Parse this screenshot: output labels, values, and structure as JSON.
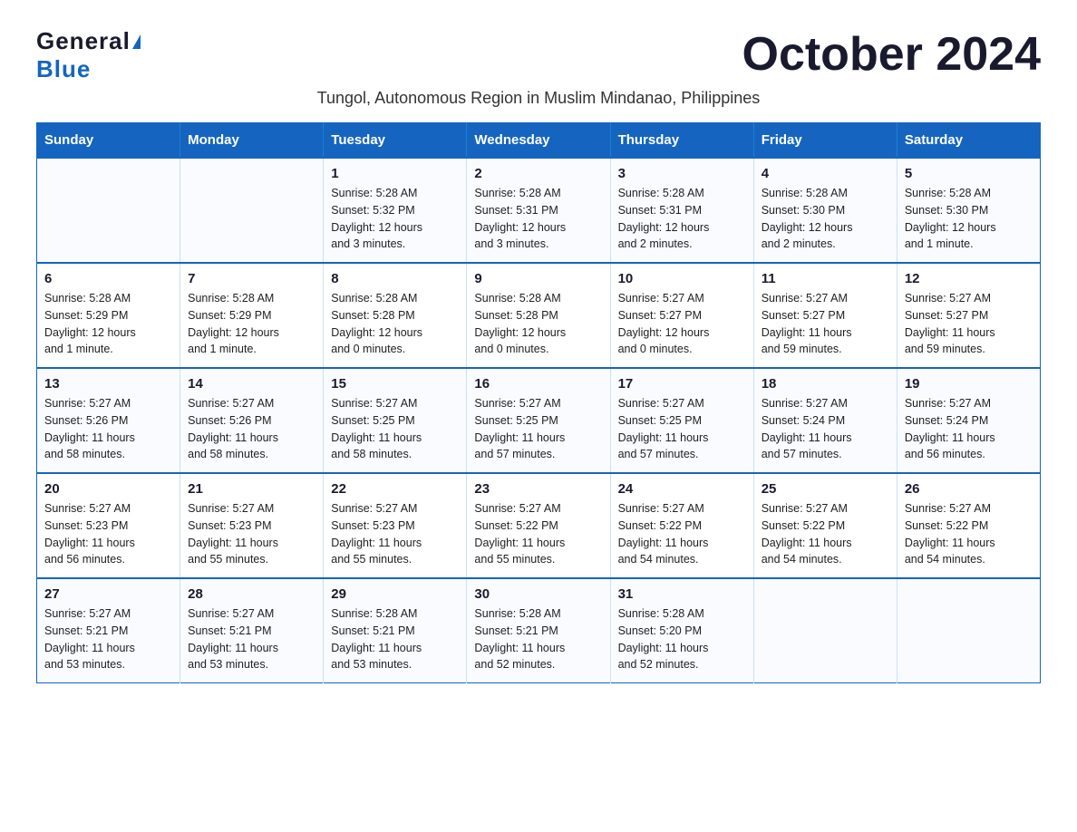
{
  "logo": {
    "general": "General",
    "blue": "Blue"
  },
  "title": "October 2024",
  "subtitle": "Tungol, Autonomous Region in Muslim Mindanao, Philippines",
  "days_of_week": [
    "Sunday",
    "Monday",
    "Tuesday",
    "Wednesday",
    "Thursday",
    "Friday",
    "Saturday"
  ],
  "weeks": [
    [
      {
        "day": "",
        "info": ""
      },
      {
        "day": "",
        "info": ""
      },
      {
        "day": "1",
        "info": "Sunrise: 5:28 AM\nSunset: 5:32 PM\nDaylight: 12 hours\nand 3 minutes."
      },
      {
        "day": "2",
        "info": "Sunrise: 5:28 AM\nSunset: 5:31 PM\nDaylight: 12 hours\nand 3 minutes."
      },
      {
        "day": "3",
        "info": "Sunrise: 5:28 AM\nSunset: 5:31 PM\nDaylight: 12 hours\nand 2 minutes."
      },
      {
        "day": "4",
        "info": "Sunrise: 5:28 AM\nSunset: 5:30 PM\nDaylight: 12 hours\nand 2 minutes."
      },
      {
        "day": "5",
        "info": "Sunrise: 5:28 AM\nSunset: 5:30 PM\nDaylight: 12 hours\nand 1 minute."
      }
    ],
    [
      {
        "day": "6",
        "info": "Sunrise: 5:28 AM\nSunset: 5:29 PM\nDaylight: 12 hours\nand 1 minute."
      },
      {
        "day": "7",
        "info": "Sunrise: 5:28 AM\nSunset: 5:29 PM\nDaylight: 12 hours\nand 1 minute."
      },
      {
        "day": "8",
        "info": "Sunrise: 5:28 AM\nSunset: 5:28 PM\nDaylight: 12 hours\nand 0 minutes."
      },
      {
        "day": "9",
        "info": "Sunrise: 5:28 AM\nSunset: 5:28 PM\nDaylight: 12 hours\nand 0 minutes."
      },
      {
        "day": "10",
        "info": "Sunrise: 5:27 AM\nSunset: 5:27 PM\nDaylight: 12 hours\nand 0 minutes."
      },
      {
        "day": "11",
        "info": "Sunrise: 5:27 AM\nSunset: 5:27 PM\nDaylight: 11 hours\nand 59 minutes."
      },
      {
        "day": "12",
        "info": "Sunrise: 5:27 AM\nSunset: 5:27 PM\nDaylight: 11 hours\nand 59 minutes."
      }
    ],
    [
      {
        "day": "13",
        "info": "Sunrise: 5:27 AM\nSunset: 5:26 PM\nDaylight: 11 hours\nand 58 minutes."
      },
      {
        "day": "14",
        "info": "Sunrise: 5:27 AM\nSunset: 5:26 PM\nDaylight: 11 hours\nand 58 minutes."
      },
      {
        "day": "15",
        "info": "Sunrise: 5:27 AM\nSunset: 5:25 PM\nDaylight: 11 hours\nand 58 minutes."
      },
      {
        "day": "16",
        "info": "Sunrise: 5:27 AM\nSunset: 5:25 PM\nDaylight: 11 hours\nand 57 minutes."
      },
      {
        "day": "17",
        "info": "Sunrise: 5:27 AM\nSunset: 5:25 PM\nDaylight: 11 hours\nand 57 minutes."
      },
      {
        "day": "18",
        "info": "Sunrise: 5:27 AM\nSunset: 5:24 PM\nDaylight: 11 hours\nand 57 minutes."
      },
      {
        "day": "19",
        "info": "Sunrise: 5:27 AM\nSunset: 5:24 PM\nDaylight: 11 hours\nand 56 minutes."
      }
    ],
    [
      {
        "day": "20",
        "info": "Sunrise: 5:27 AM\nSunset: 5:23 PM\nDaylight: 11 hours\nand 56 minutes."
      },
      {
        "day": "21",
        "info": "Sunrise: 5:27 AM\nSunset: 5:23 PM\nDaylight: 11 hours\nand 55 minutes."
      },
      {
        "day": "22",
        "info": "Sunrise: 5:27 AM\nSunset: 5:23 PM\nDaylight: 11 hours\nand 55 minutes."
      },
      {
        "day": "23",
        "info": "Sunrise: 5:27 AM\nSunset: 5:22 PM\nDaylight: 11 hours\nand 55 minutes."
      },
      {
        "day": "24",
        "info": "Sunrise: 5:27 AM\nSunset: 5:22 PM\nDaylight: 11 hours\nand 54 minutes."
      },
      {
        "day": "25",
        "info": "Sunrise: 5:27 AM\nSunset: 5:22 PM\nDaylight: 11 hours\nand 54 minutes."
      },
      {
        "day": "26",
        "info": "Sunrise: 5:27 AM\nSunset: 5:22 PM\nDaylight: 11 hours\nand 54 minutes."
      }
    ],
    [
      {
        "day": "27",
        "info": "Sunrise: 5:27 AM\nSunset: 5:21 PM\nDaylight: 11 hours\nand 53 minutes."
      },
      {
        "day": "28",
        "info": "Sunrise: 5:27 AM\nSunset: 5:21 PM\nDaylight: 11 hours\nand 53 minutes."
      },
      {
        "day": "29",
        "info": "Sunrise: 5:28 AM\nSunset: 5:21 PM\nDaylight: 11 hours\nand 53 minutes."
      },
      {
        "day": "30",
        "info": "Sunrise: 5:28 AM\nSunset: 5:21 PM\nDaylight: 11 hours\nand 52 minutes."
      },
      {
        "day": "31",
        "info": "Sunrise: 5:28 AM\nSunset: 5:20 PM\nDaylight: 11 hours\nand 52 minutes."
      },
      {
        "day": "",
        "info": ""
      },
      {
        "day": "",
        "info": ""
      }
    ]
  ]
}
